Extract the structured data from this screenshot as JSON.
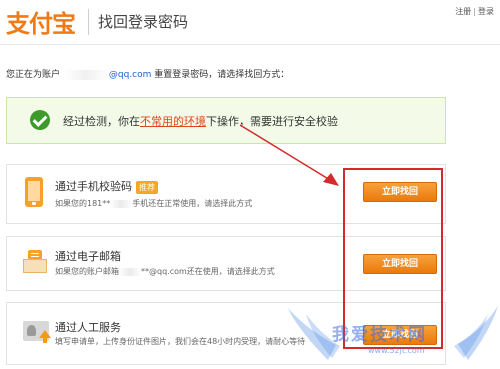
{
  "header": {
    "logo_text": "支付宝",
    "title": "找回登录密码",
    "register_link": "注册",
    "login_link": "登录",
    "link_separator": "|"
  },
  "intro": {
    "prefix": "您正在为账户",
    "account_suffix": "@qq.com",
    "suffix": "重置登录密码，请选择找回方式："
  },
  "notice": {
    "part1": "经过检测，你在",
    "highlight": "不常用的环境",
    "part2": "下操作，需要进行安全校验"
  },
  "options": [
    {
      "title": "通过手机校验码",
      "badge": "推荐",
      "desc_prefix": "如果您的181**",
      "desc_suffix": "手机还在正常使用，请选择此方式",
      "button": "立即找回",
      "icon": "phone-icon"
    },
    {
      "title": "通过电子邮箱",
      "desc_prefix": "如果您的账户邮箱",
      "desc_suffix": "**@qq.com还在使用，请选择此方式",
      "button": "立即找回",
      "icon": "mail-icon"
    },
    {
      "title": "通过人工服务",
      "desc": "填写申请单，上传身份证件图片，我们会在48小时内受理，请耐心等待",
      "button": "立即找回",
      "icon": "id-card-upload-icon"
    }
  ],
  "watermark": {
    "text": "我爱技术网",
    "url": "www.52jt.com"
  },
  "colors": {
    "brand_orange": "#f07a14",
    "button_orange": "#ea7a0c",
    "notice_bg": "#f3fbe8",
    "highlight_red": "#e0451a",
    "annotation_red": "#d32b2b"
  }
}
